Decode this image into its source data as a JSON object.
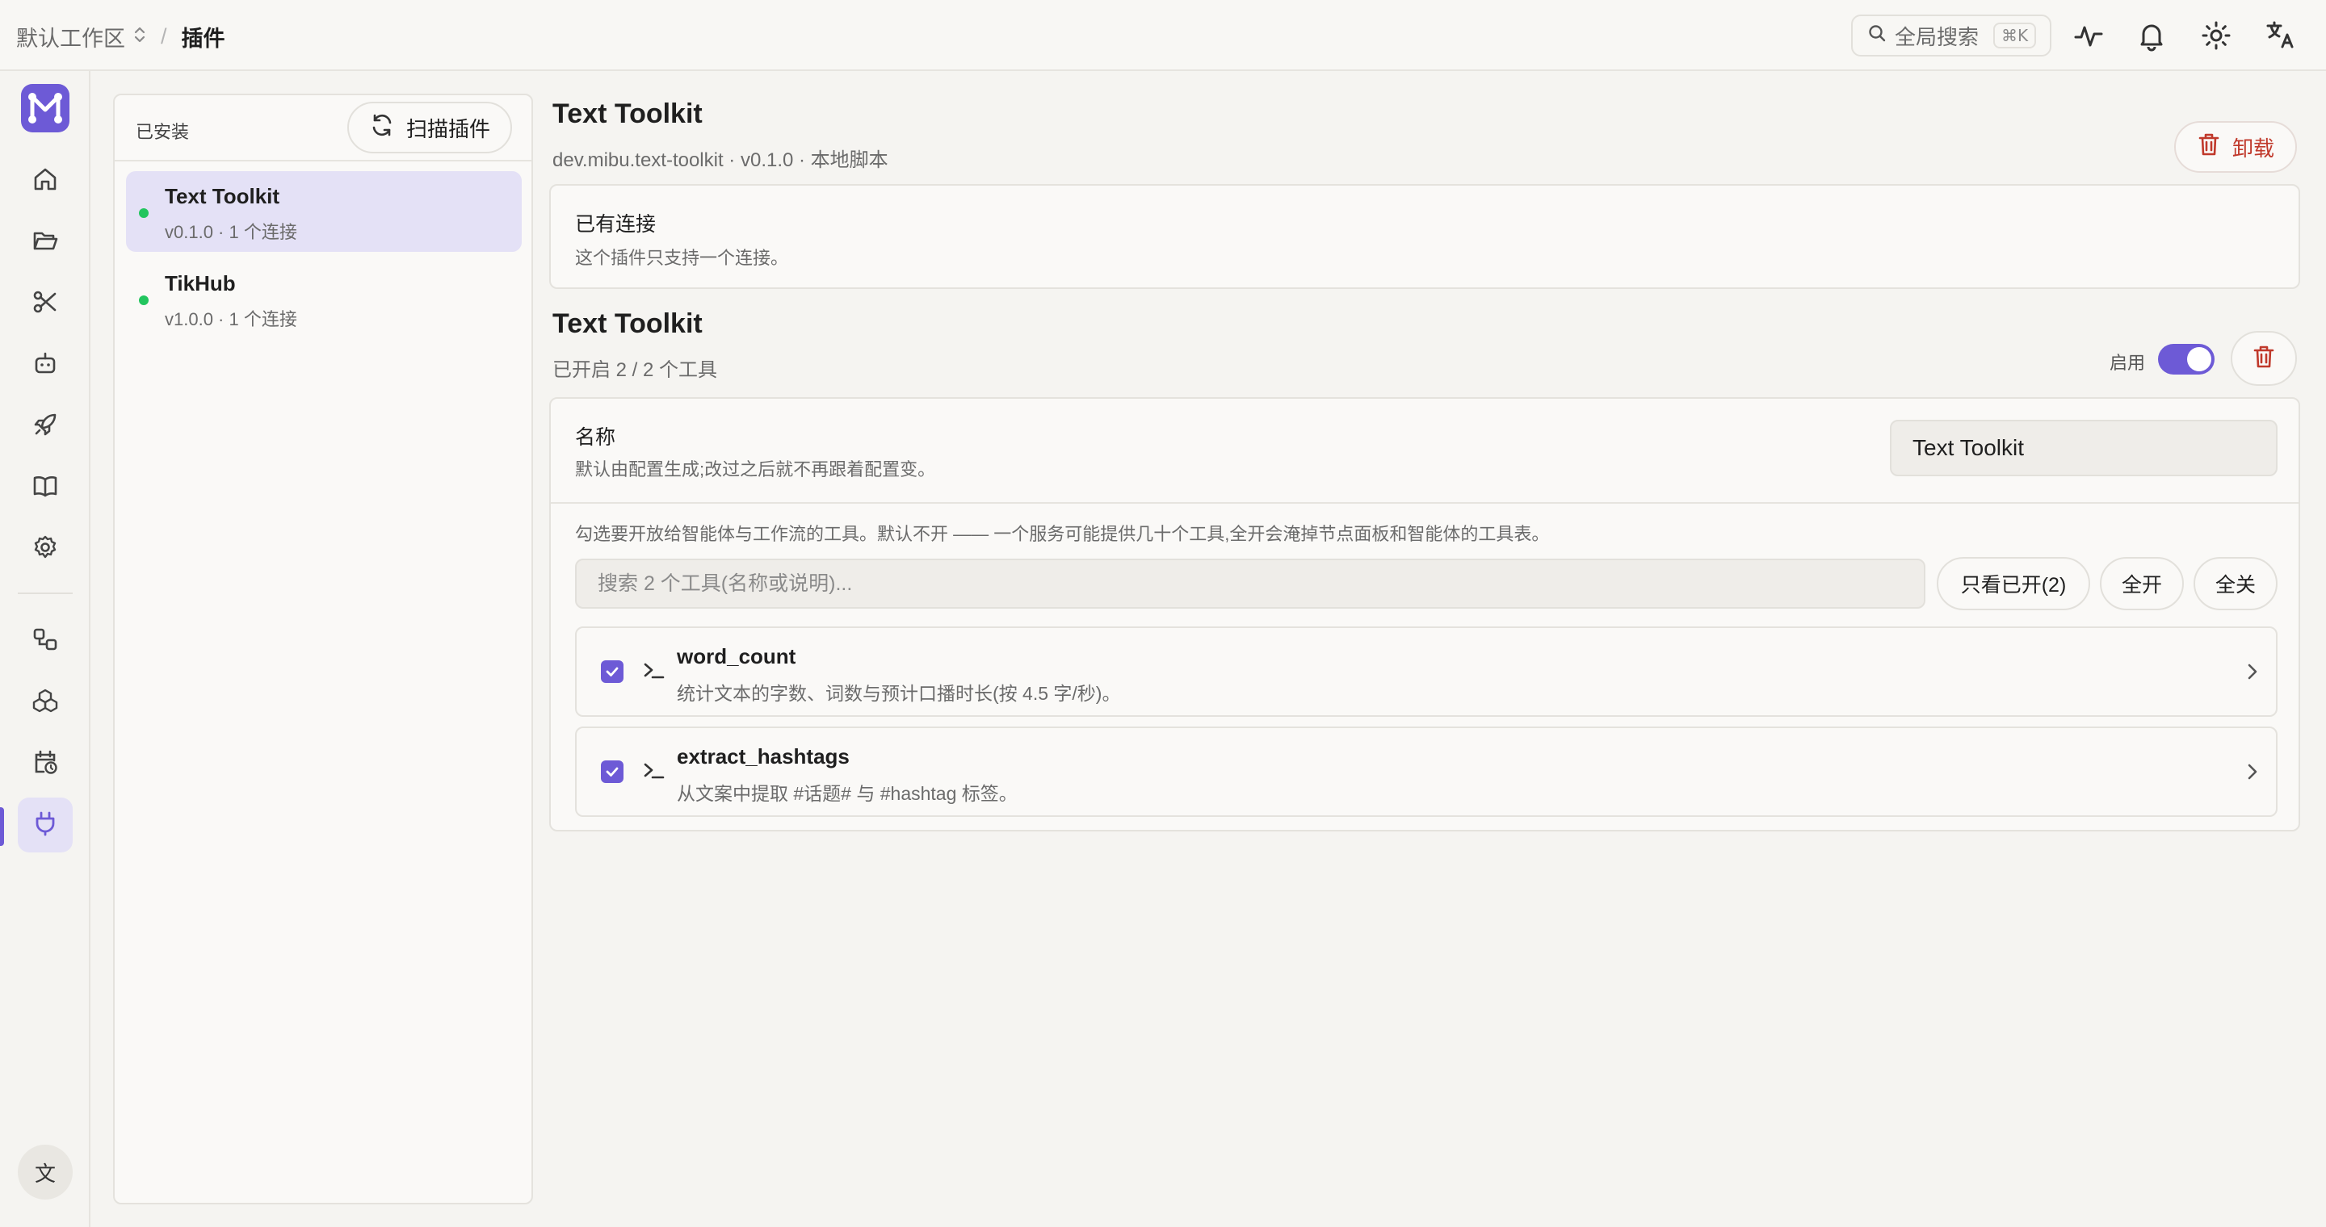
{
  "topbar": {
    "workspace": "默认工作区",
    "separator": "/",
    "current_page": "插件",
    "search_label": "全局搜索",
    "search_shortcut": "⌘K"
  },
  "rail": {
    "lang_button": "文",
    "accent": "#6d5ad6"
  },
  "plugin_list": {
    "title": "已安装",
    "scan_button": "扫描插件",
    "items": [
      {
        "name": "Text Toolkit",
        "meta": "v0.1.0 · 1 个连接",
        "status": "active"
      },
      {
        "name": "TikHub",
        "meta": "v1.0.0 · 1 个连接",
        "status": "active"
      }
    ]
  },
  "plugin": {
    "title": "Text Toolkit",
    "subtitle": "dev.mibu.text-toolkit · v0.1.0 · 本地脚本",
    "uninstall_button": "卸载",
    "connections": {
      "title": "已有连接",
      "desc": "这个插件只支持一个连接。"
    },
    "connection": {
      "title": "Text Toolkit",
      "summary": "已开启 2 / 2 个工具",
      "enable_label": "启用",
      "enabled": true,
      "name_label": "名称",
      "name_desc": "默认由配置生成;改过之后就不再跟着配置变。",
      "name_value": "Text Toolkit",
      "tools_hint": "勾选要开放给智能体与工作流的工具。默认不开 —— 一个服务可能提供几十个工具,全开会淹掉节点面板和智能体的工具表。",
      "tools_search_placeholder": "搜索 2 个工具(名称或说明)...",
      "filter_button": "只看已开(2)",
      "enable_all_button": "全开",
      "disable_all_button": "全关",
      "tools": [
        {
          "name": "word_count",
          "desc": "统计文本的字数、词数与预计口播时长(按 4.5 字/秒)。",
          "checked": true
        },
        {
          "name": "extract_hashtags",
          "desc": "从文案中提取 #话题# 与 #hashtag 标签。",
          "checked": true
        }
      ]
    }
  },
  "colors": {
    "accent": "#6d5ad6",
    "status_green": "#22c55e",
    "danger": "#c0392b"
  }
}
